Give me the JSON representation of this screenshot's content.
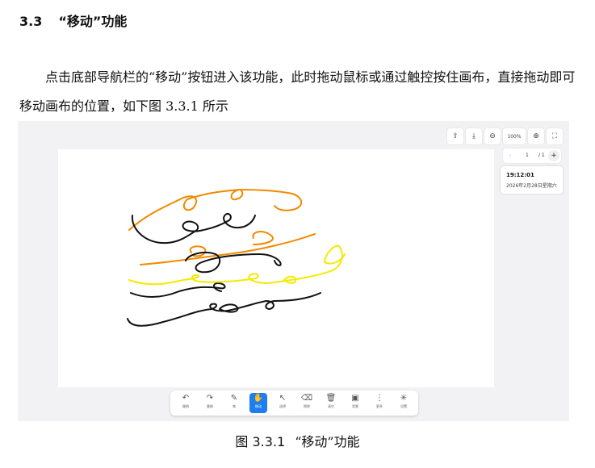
{
  "heading": {
    "number": "3.3",
    "title": "“移动”功能"
  },
  "paragraph": "点击底部导航栏的“移动”按钮进入该功能，此时拖动鼠标或通过触控按住画布，直接拖动即可移动画布的位置，如下图 3.3.1 所示",
  "figure": {
    "top_icons": [
      {
        "name": "upload-icon",
        "glyph": "⇪"
      },
      {
        "name": "download-icon",
        "glyph": "⤓"
      },
      {
        "name": "zoom-out-icon",
        "glyph": "⊖"
      },
      {
        "name": "zoom-level",
        "glyph": "100%"
      },
      {
        "name": "zoom-in-icon",
        "glyph": "⊕"
      },
      {
        "name": "fullscreen-icon",
        "glyph": "⛶"
      }
    ],
    "pager": {
      "prev": "‹",
      "current": "1",
      "total": "/ 1",
      "add": "+"
    },
    "clock": {
      "time": "19:12:01",
      "date": "2026年2月28日星期六"
    },
    "toolbar": [
      {
        "name": "undo",
        "glyph": "↶",
        "label": "撤销",
        "active": false
      },
      {
        "name": "redo",
        "glyph": "↷",
        "label": "重做",
        "active": false
      },
      {
        "name": "pen",
        "glyph": "✎",
        "label": "笔",
        "active": false
      },
      {
        "name": "move",
        "glyph": "✋",
        "label": "移动",
        "active": true
      },
      {
        "name": "select",
        "glyph": "↖",
        "label": "选择",
        "active": false
      },
      {
        "name": "eraser",
        "glyph": "⌫",
        "label": "擦除",
        "active": false
      },
      {
        "name": "clear",
        "glyph": "🗑",
        "label": "清空",
        "active": false
      },
      {
        "name": "background",
        "glyph": "▣",
        "label": "背景",
        "active": false
      },
      {
        "name": "more",
        "glyph": "⋮",
        "label": "更多",
        "active": false
      },
      {
        "name": "settings",
        "glyph": "✳",
        "label": "设置",
        "active": false
      }
    ],
    "colors": {
      "black": "#111111",
      "orange": "#f08a00",
      "yellow": "#f5ea00",
      "accent": "#1e7ef0"
    }
  },
  "caption": {
    "number": "图 3.3.1",
    "title": "“移动”功能"
  }
}
